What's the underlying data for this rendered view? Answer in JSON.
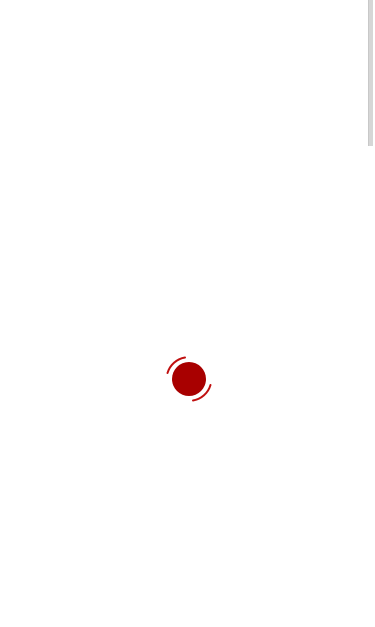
{
  "colors": {
    "loader_primary": "#a80000",
    "loader_ring": "#c01010",
    "background": "#ffffff"
  },
  "loader": {
    "state": "loading",
    "icon": "spinner-icon"
  },
  "scrollbar": {
    "visible": true
  }
}
